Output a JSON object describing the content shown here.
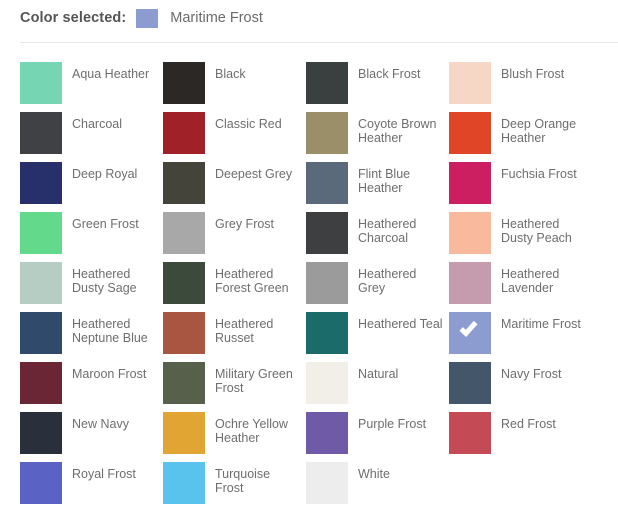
{
  "header": {
    "label": "Color selected:",
    "selected_color_name": "Maritime Frost",
    "selected_color_hex": "#8c9cd0"
  },
  "grid": {
    "columns": 4,
    "swatches": [
      {
        "name": "Aqua Heather",
        "hex": "#76d6b4",
        "selected": false
      },
      {
        "name": "Black",
        "hex": "#2b2826",
        "selected": false
      },
      {
        "name": "Black Frost",
        "hex": "#39403f",
        "selected": false
      },
      {
        "name": "Blush Frost",
        "hex": "#f6d7c6",
        "selected": false
      },
      {
        "name": "Charcoal",
        "hex": "#3f4144",
        "selected": false
      },
      {
        "name": "Classic Red",
        "hex": "#a02128",
        "selected": false
      },
      {
        "name": "Coyote Brown Heather",
        "hex": "#9b8f6a",
        "selected": false
      },
      {
        "name": "Deep Orange Heather",
        "hex": "#df4526",
        "selected": false
      },
      {
        "name": "Deep Royal",
        "hex": "#27306a",
        "selected": false
      },
      {
        "name": "Deepest Grey",
        "hex": "#44443a",
        "selected": false
      },
      {
        "name": "Flint Blue Heather",
        "hex": "#5a6a7a",
        "selected": false
      },
      {
        "name": "Fuchsia Frost",
        "hex": "#cc1f62",
        "selected": false
      },
      {
        "name": "Green Frost",
        "hex": "#62d98b",
        "selected": false
      },
      {
        "name": "Grey Frost",
        "hex": "#a8a8a8",
        "selected": false
      },
      {
        "name": "Heathered Charcoal",
        "hex": "#3d3f40",
        "selected": false
      },
      {
        "name": "Heathered Dusty Peach",
        "hex": "#f8b99d",
        "selected": false
      },
      {
        "name": "Heathered Dusty Sage",
        "hex": "#b6cdc3",
        "selected": false
      },
      {
        "name": "Heathered Forest Green",
        "hex": "#3b4a3a",
        "selected": false
      },
      {
        "name": "Heathered Grey",
        "hex": "#9b9b9b",
        "selected": false
      },
      {
        "name": "Heathered Lavender",
        "hex": "#c49cae",
        "selected": false
      },
      {
        "name": "Heathered Neptune Blue",
        "hex": "#2f4a6b",
        "selected": false
      },
      {
        "name": "Heathered Russet",
        "hex": "#a85541",
        "selected": false
      },
      {
        "name": "Heathered Teal",
        "hex": "#1c6b6b",
        "selected": false
      },
      {
        "name": "Maritime Frost",
        "hex": "#8c9cd0",
        "selected": true
      },
      {
        "name": "Maroon Frost",
        "hex": "#6a2634",
        "selected": false
      },
      {
        "name": "Military Green Frost",
        "hex": "#56604a",
        "selected": false
      },
      {
        "name": "Natural",
        "hex": "#f2efe9",
        "selected": false
      },
      {
        "name": "Navy Frost",
        "hex": "#44566a",
        "selected": false
      },
      {
        "name": "New Navy",
        "hex": "#2a2f3c",
        "selected": false
      },
      {
        "name": "Ochre Yellow Heather",
        "hex": "#e0a532",
        "selected": false
      },
      {
        "name": "Purple Frost",
        "hex": "#6f5aa8",
        "selected": false
      },
      {
        "name": "Red Frost",
        "hex": "#c44a56",
        "selected": false
      },
      {
        "name": "Royal Frost",
        "hex": "#5a63c4",
        "selected": false
      },
      {
        "name": "Turquoise Frost",
        "hex": "#5ac3ed",
        "selected": false
      },
      {
        "name": "White",
        "hex": "#ededed",
        "selected": false
      }
    ]
  }
}
